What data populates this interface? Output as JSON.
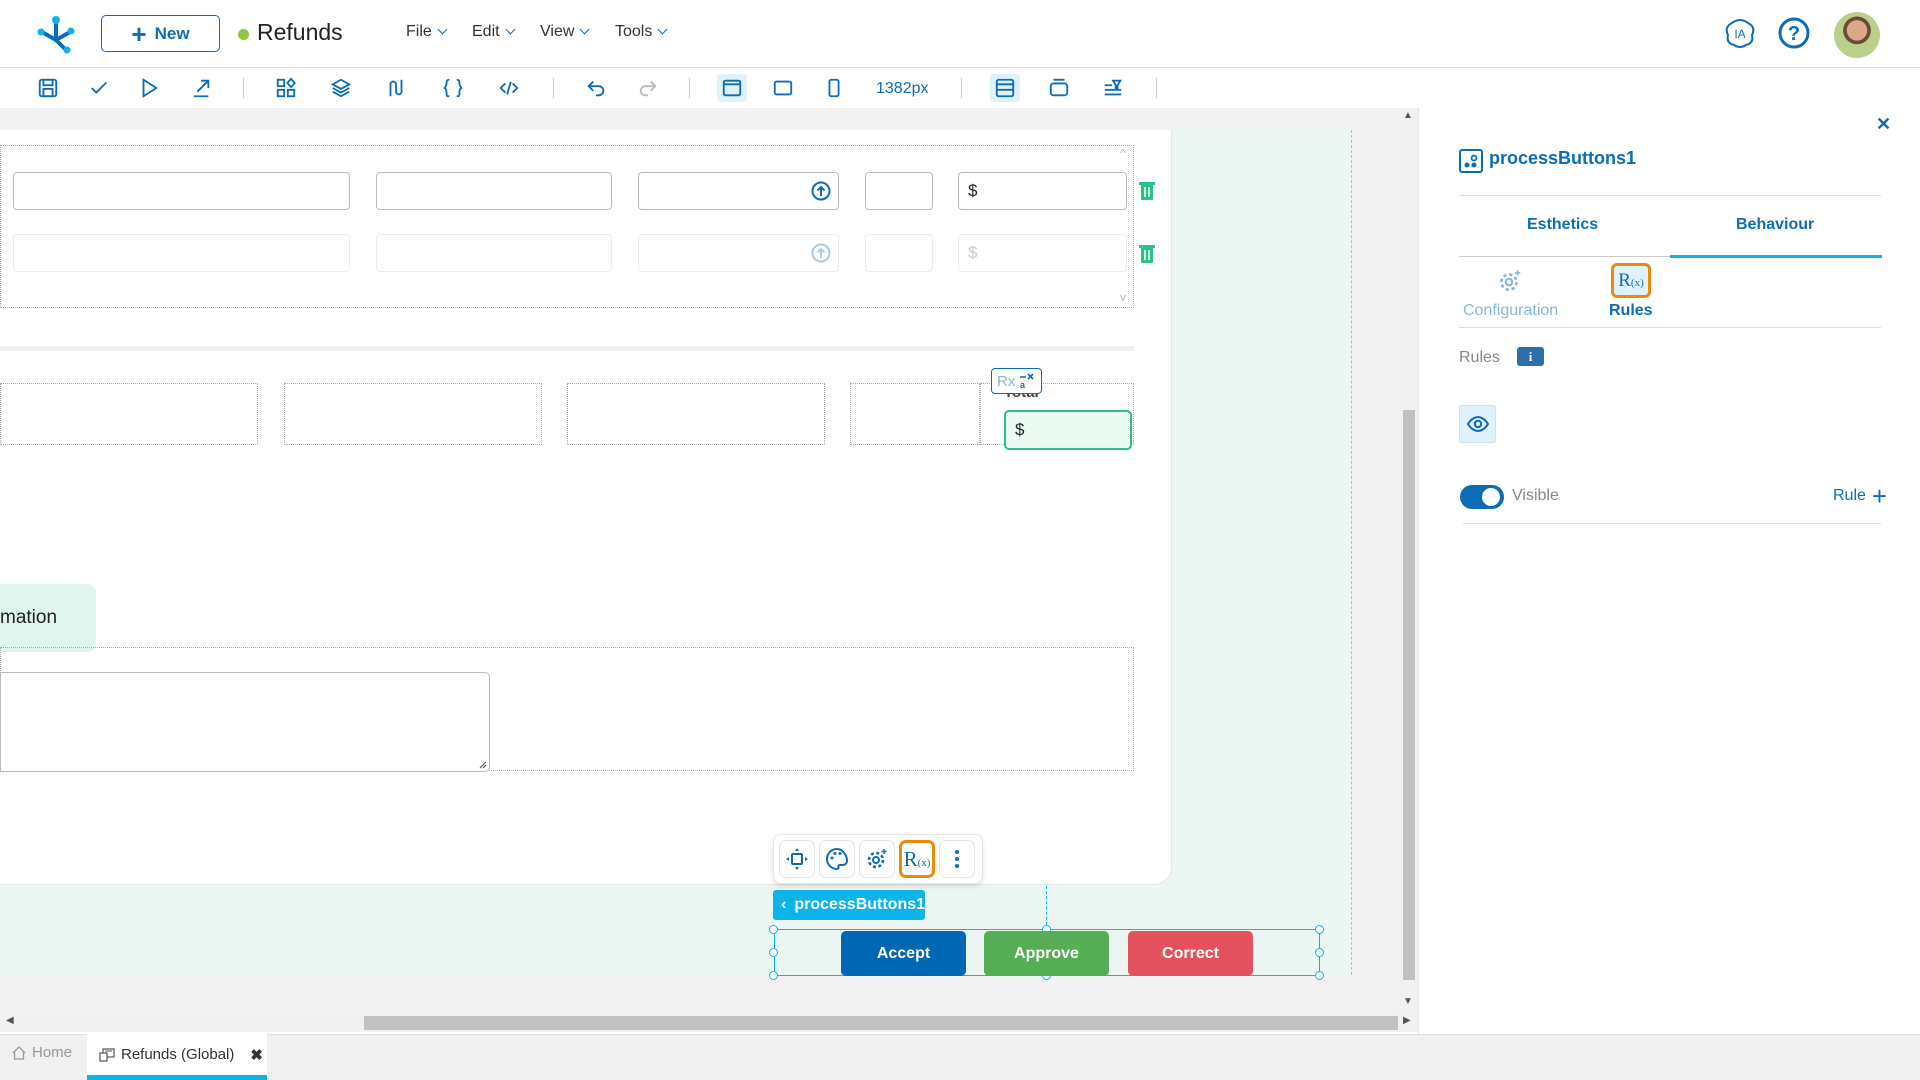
{
  "header": {
    "new_button": "New",
    "doc_title": "Refunds",
    "status_color": "#8dc63f",
    "menus": [
      "File",
      "Edit",
      "View",
      "Tools"
    ],
    "ia_label": "IA",
    "help_icon": "help-circle-icon"
  },
  "toolbar": {
    "buttons": [
      "save",
      "validate",
      "run",
      "export",
      "components",
      "layers",
      "flows",
      "braces",
      "code",
      "undo",
      "redo",
      "desktop",
      "tablet",
      "mobile"
    ],
    "width_readout": "1382px",
    "right_buttons": [
      "layout-panel",
      "container",
      "filter-bar"
    ]
  },
  "canvas": {
    "grid_rows": [
      {
        "currency": "$",
        "state": "active"
      },
      {
        "currency": "$",
        "state": "faint"
      }
    ],
    "total_label": "Total",
    "total_currency": "$",
    "rx_badge": "Rx",
    "info_chip": "mation",
    "component_toolbar": [
      "move",
      "palette",
      "configuration",
      "rules",
      "more"
    ],
    "component_tag": "processButtons1",
    "process_buttons": [
      {
        "label": "Accept",
        "color": "#0067b5"
      },
      {
        "label": "Approve",
        "color": "#55ad56"
      },
      {
        "label": "Correct",
        "color": "#e5525f"
      }
    ]
  },
  "panel": {
    "title": "processButtons1",
    "tabs": [
      "Esthetics",
      "Behaviour"
    ],
    "active_tab": "Behaviour",
    "subtabs": [
      "Configuration",
      "Rules"
    ],
    "active_subtab": "Rules",
    "rules_label": "Rules",
    "info_glyph": "i",
    "visible_label": "Visible",
    "visible_on": true,
    "rule_button": "Rule",
    "accent": "#0b6db8",
    "highlight": "#f0880a"
  },
  "bottom_tabs": {
    "home": "Home",
    "active": "Refunds (Global)"
  }
}
